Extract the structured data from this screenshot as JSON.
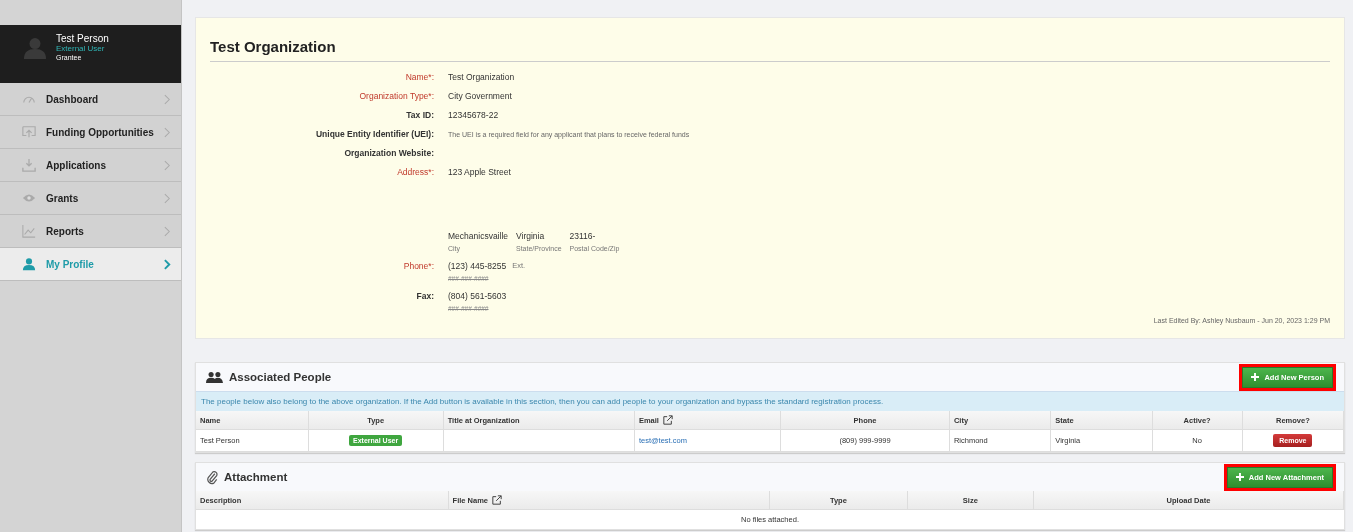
{
  "user": {
    "name": "Test Person",
    "role": "External User",
    "group": "Grantee"
  },
  "nav": [
    {
      "label": "Dashboard",
      "kind": "gauge",
      "selected": false
    },
    {
      "label": "Funding Opportunities",
      "kind": "upload",
      "selected": false
    },
    {
      "label": "Applications",
      "kind": "download",
      "selected": false
    },
    {
      "label": "Grants",
      "kind": "eye",
      "selected": false
    },
    {
      "label": "Reports",
      "kind": "chart",
      "selected": false
    },
    {
      "label": "My Profile",
      "kind": "person",
      "selected": true
    }
  ],
  "organization": {
    "title": "Test Organization",
    "fields": [
      {
        "label": "Name*:",
        "required": true,
        "value": "Test Organization"
      },
      {
        "label": "Organization Type*:",
        "required": true,
        "value": "City Government"
      },
      {
        "label": "Tax ID:",
        "required": false,
        "value": "12345678-22"
      },
      {
        "label": "Unique Entity Identifier (UEI):",
        "required": false,
        "hint": "The UEI is a required field for any applicant that plans to receive federal funds"
      },
      {
        "label": "Organization Website:",
        "required": false
      },
      {
        "label": "Address*:",
        "required": true,
        "value": "123 Apple Street"
      }
    ],
    "address_parts": [
      {
        "value": "Mechanicsvaille",
        "caption": "City"
      },
      {
        "value": "Virginia",
        "caption": "State/Province"
      },
      {
        "value": "23116-",
        "caption": "Postal Code/Zip"
      }
    ],
    "contacts": [
      {
        "label": "Phone*:",
        "required": true,
        "value": "(123) 445-8255",
        "ext": "Ext.",
        "mask": "###-###-####"
      },
      {
        "label": "Fax:",
        "required": false,
        "value": "(804) 561-5603",
        "mask": "###-###-####"
      }
    ],
    "last_edited": "Last Edited By: Ashley Nusbaum - Jun 20, 2023 1:29 PM"
  },
  "people": {
    "title": "Associated People",
    "button": {
      "label": "Add New Person",
      "highlighted": true
    },
    "notice": "The people below also belong to the above organization. If the Add button is available in this section, then you can add people to your organization and bypass the standard registration process.",
    "columns": [
      {
        "label": "Name",
        "link": false
      },
      {
        "label": "Type",
        "link": false
      },
      {
        "label": "Title at Organization",
        "link": false
      },
      {
        "label": "Email",
        "link": true
      },
      {
        "label": "Phone",
        "link": false
      },
      {
        "label": "City",
        "link": false
      },
      {
        "label": "State",
        "link": false
      },
      {
        "label": "Active?",
        "link": false
      },
      {
        "label": "Remove?",
        "link": false
      }
    ],
    "rows": [
      {
        "name": "Test Person",
        "type": "External User",
        "email": "test@test.com",
        "phone": "(809) 999-9999",
        "city": "Richmond",
        "state": "Virginia",
        "active": "No",
        "remove": "Remove"
      }
    ]
  },
  "attachments": {
    "title": "Attachment",
    "button": {
      "label": "Add New Attachment",
      "highlighted": true
    },
    "columns": [
      {
        "label": "Description",
        "link": false
      },
      {
        "label": "File Name",
        "link": true
      },
      {
        "label": "Type",
        "link": false
      },
      {
        "label": "Size",
        "link": false
      },
      {
        "label": "Upload Date",
        "link": false
      }
    ],
    "empty": "No files attached."
  }
}
